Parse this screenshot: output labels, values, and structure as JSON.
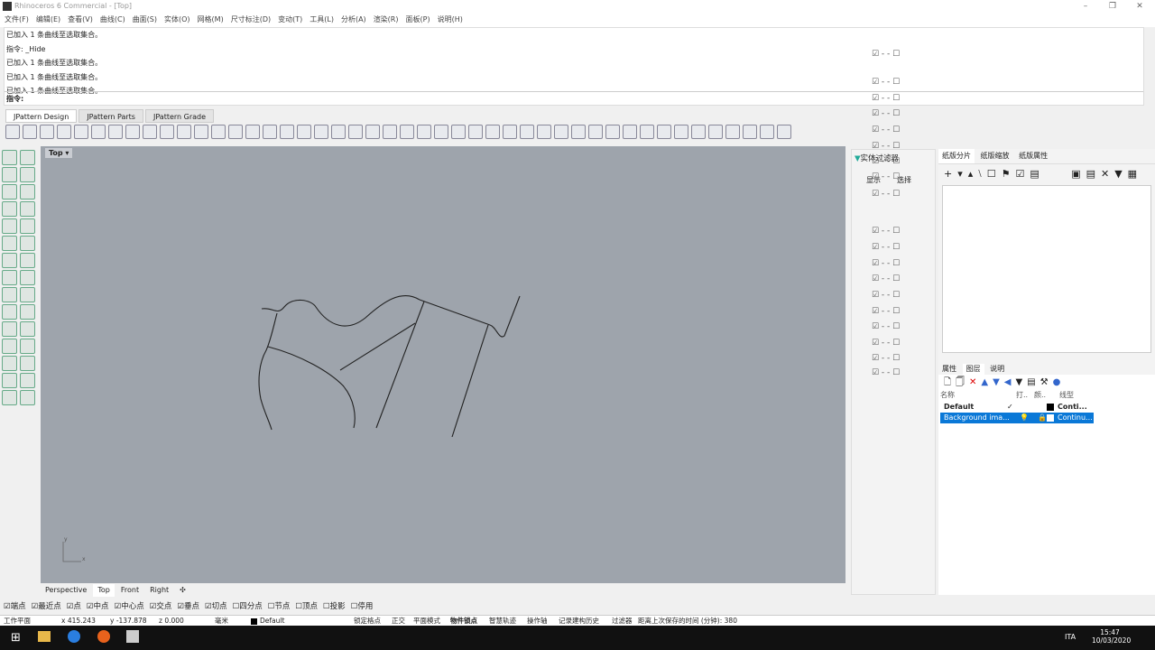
{
  "window": {
    "title": "Rhinoceros 6 Commercial - [Top]"
  },
  "menu": [
    "文件(F)",
    "编辑(E)",
    "查看(V)",
    "曲线(C)",
    "曲面(S)",
    "实体(O)",
    "网格(M)",
    "尺寸标注(D)",
    "变动(T)",
    "工具(L)",
    "分析(A)",
    "渲染(R)",
    "面板(P)",
    "说明(H)"
  ],
  "command": {
    "history": [
      "已加入 1 条曲线至选取集合。",
      "指令: _Hide",
      "已加入 1 条曲线至选取集合。",
      "已加入 1 条曲线至选取集合。",
      "已加入 1 条曲线至选取集合。"
    ],
    "prompt": "指令:"
  },
  "toolbar_tabs": [
    "JPattern Design",
    "JPattern Parts",
    "JPattern Grade"
  ],
  "viewport": {
    "label": "Top",
    "tabs": [
      "Perspective",
      "Top",
      "Front",
      "Right"
    ],
    "axis_x": "x",
    "axis_y": "y"
  },
  "filter": {
    "title": "实体过滤器",
    "show": "显示",
    "select": "选择"
  },
  "right_panel": {
    "tabs": [
      "纸版分片",
      "纸版缩放",
      "纸版属性"
    ],
    "bottom_tabs": [
      "属性",
      "图层",
      "说明"
    ],
    "layer_headers": [
      "名称",
      "打..",
      "颜..",
      "线型"
    ],
    "layers": [
      {
        "name": "Default",
        "current": "✓",
        "linetype": "Conti..."
      },
      {
        "name": "Background ima...",
        "linetype": "Continu..."
      }
    ]
  },
  "osnap": [
    {
      "label": "端点",
      "checked": true
    },
    {
      "label": "最近点",
      "checked": true
    },
    {
      "label": "点",
      "checked": true
    },
    {
      "label": "中点",
      "checked": true
    },
    {
      "label": "中心点",
      "checked": true
    },
    {
      "label": "交点",
      "checked": true
    },
    {
      "label": "垂点",
      "checked": true
    },
    {
      "label": "切点",
      "checked": true
    },
    {
      "label": "四分点",
      "checked": false
    },
    {
      "label": "节点",
      "checked": false
    },
    {
      "label": "顶点",
      "checked": false
    },
    {
      "label": "投影",
      "checked": false
    },
    {
      "label": "停用",
      "checked": false
    }
  ],
  "status": {
    "cplane": "工作平面",
    "x": "x 415.243",
    "y": "y -137.878",
    "z": "z 0.000",
    "units": "毫米",
    "layer": "Default",
    "grid_snap": "锁定格点",
    "ortho": "正交",
    "planar": "平面模式",
    "osnap": "物件锁点",
    "smarttrack": "智慧轨迹",
    "gumball": "操作轴",
    "history": "记录建构历史",
    "filter": "过滤器",
    "autosave": "距离上次保存的时间 (分钟): 380"
  },
  "taskbar": {
    "time": "15:47",
    "date": "10/03/2020",
    "lang": "ITA"
  }
}
